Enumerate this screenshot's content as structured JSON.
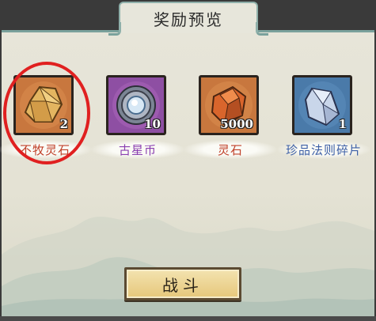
{
  "dialog": {
    "title": "奖励预览"
  },
  "rewards": [
    {
      "name": "不牧灵石",
      "count": "2",
      "icon": "amber-stone-icon",
      "label_color": "#c0412a",
      "bg_color": "#c8773e"
    },
    {
      "name": "古星币",
      "count": "10",
      "icon": "ancient-star-coin-icon",
      "label_color": "#8a3fb0",
      "bg_color": "#8e4fa3"
    },
    {
      "name": "灵石",
      "count": "5000",
      "icon": "spirit-stone-icon",
      "label_color": "#c0412a",
      "bg_color": "#c8773e"
    },
    {
      "name": "珍品法则碎片",
      "count": "1",
      "icon": "rare-rule-fragment-icon",
      "label_color": "#3c5fa6",
      "bg_color": "#4a7aa9"
    }
  ],
  "button": {
    "fight_label": "战斗"
  },
  "highlight": {
    "target": "不牧灵石",
    "color": "#e02020"
  }
}
